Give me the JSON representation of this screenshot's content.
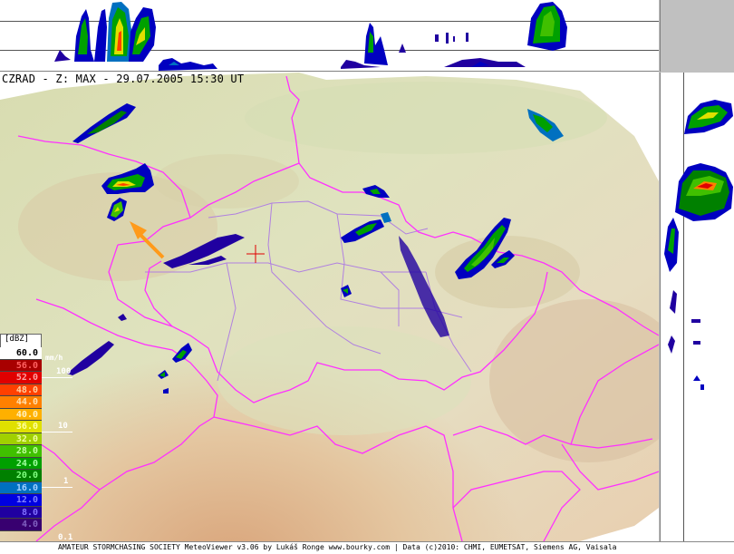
{
  "title": "CZRAD - Z: MAX - 29.07.2005 15:30 UT",
  "footer": "AMATEUR STORMCHASING SOCIETY MeteoViewer v3.06 by Lukáš Ronge www.bourky.com | Data (c)2010: CHMI, EUMETSAT, Siemens AG, Vaisala",
  "legend": {
    "unit": "[dBZ]",
    "mm_label": "mm/h",
    "levels": [
      {
        "value": "60.0",
        "color": "#ffffff",
        "text_color": "#000000"
      },
      {
        "value": "56.0",
        "color": "#a80000",
        "text_color": "#ff6060"
      },
      {
        "value": "52.0",
        "color": "#e00000",
        "text_color": "#ffa0a0"
      },
      {
        "value": "48.0",
        "color": "#ff4000",
        "text_color": "#ffd0a0"
      },
      {
        "value": "44.0",
        "color": "#ff8000",
        "text_color": "#ffe0b0"
      },
      {
        "value": "40.0",
        "color": "#ffb000",
        "text_color": "#fff0c0"
      },
      {
        "value": "36.0",
        "color": "#e0e000",
        "text_color": "#ffffa0"
      },
      {
        "value": "32.0",
        "color": "#a0d000",
        "text_color": "#f0ffa0"
      },
      {
        "value": "28.0",
        "color": "#40c000",
        "text_color": "#c0ffa0"
      },
      {
        "value": "24.0",
        "color": "#00a000",
        "text_color": "#a0ffa0"
      },
      {
        "value": "20.0",
        "color": "#008000",
        "text_color": "#80ff80"
      },
      {
        "value": "16.0",
        "color": "#0070c0",
        "text_color": "#a0d0ff"
      },
      {
        "value": "12.0",
        "color": "#0000e0",
        "text_color": "#8080ff"
      },
      {
        "value": "8.0",
        "color": "#2000a0",
        "text_color": "#8070ff"
      },
      {
        "value": "4.0",
        "color": "#380070",
        "text_color": "#8060c0"
      }
    ],
    "rain_marks": [
      "100",
      "10",
      "1",
      "0.1"
    ]
  },
  "map_colors": {
    "border": "#ff30ff",
    "region": "#b080e0",
    "background": "#ffffff",
    "arrow": "#ff9a1a",
    "radar_site": "#e00000"
  },
  "icons": {
    "radar_site": "crosshair-icon",
    "storm_motion": "arrow-icon"
  }
}
